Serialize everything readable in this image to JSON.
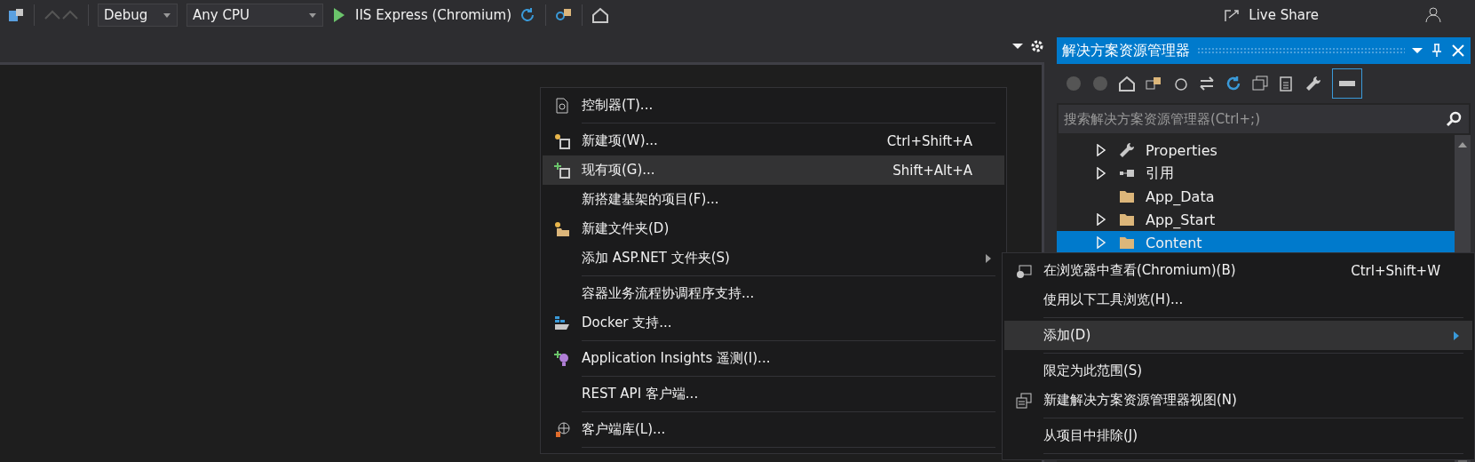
{
  "toolbar": {
    "configuration": "Debug",
    "platform": "Any CPU",
    "run_target": "IIS Express (Chromium)",
    "live_share": "Live Share"
  },
  "solution_explorer": {
    "title": "解决方案资源管理器",
    "search": {
      "placeholder": "搜索解决方案资源管理器(Ctrl+;)"
    },
    "tree": [
      {
        "label": "Properties",
        "kind": "wrench",
        "expandable": true,
        "selected": false
      },
      {
        "label": "引用",
        "kind": "references",
        "expandable": true,
        "selected": false
      },
      {
        "label": "App_Data",
        "kind": "folder",
        "expandable": false,
        "selected": false
      },
      {
        "label": "App_Start",
        "kind": "folder",
        "expandable": true,
        "selected": false
      },
      {
        "label": "Content",
        "kind": "folder",
        "expandable": true,
        "selected": true
      }
    ]
  },
  "add_submenu": {
    "items": [
      {
        "kind": "controller",
        "label": "控制器(T)...",
        "submenu": false,
        "selected": false
      },
      {
        "kind": "separator"
      },
      {
        "kind": "new-item",
        "label": "新建项(W)...",
        "shortcut": "Ctrl+Shift+A",
        "submenu": false,
        "selected": false
      },
      {
        "kind": "existing-item",
        "label": "现有项(G)...",
        "shortcut": "Shift+Alt+A",
        "submenu": false,
        "selected": true
      },
      {
        "kind": "plain",
        "label": "新搭建基架的项目(F)...",
        "submenu": false,
        "selected": false
      },
      {
        "kind": "new-folder",
        "label": "新建文件夹(D)",
        "submenu": false,
        "selected": false
      },
      {
        "kind": "plain",
        "label": "添加 ASP.NET 文件夹(S)",
        "submenu": true,
        "selected": false
      },
      {
        "kind": "separator"
      },
      {
        "kind": "plain",
        "label": "容器业务流程协调程序支持...",
        "submenu": false,
        "selected": false
      },
      {
        "kind": "docker",
        "label": "Docker 支持...",
        "submenu": false,
        "selected": false
      },
      {
        "kind": "separator"
      },
      {
        "kind": "insights",
        "label": "Application Insights 遥测(I)...",
        "submenu": false,
        "selected": false
      },
      {
        "kind": "separator"
      },
      {
        "kind": "plain",
        "label": "REST API 客户端...",
        "submenu": false,
        "selected": false
      },
      {
        "kind": "separator"
      },
      {
        "kind": "library",
        "label": "客户端库(L)...",
        "submenu": false,
        "selected": false
      },
      {
        "kind": "separator"
      }
    ]
  },
  "folder_menu": {
    "items": [
      {
        "kind": "browser",
        "label": "在浏览器中查看(Chromium)(B)",
        "shortcut": "Ctrl+Shift+W",
        "submenu": false,
        "selected": false
      },
      {
        "kind": "plain",
        "label": "使用以下工具浏览(H)...",
        "submenu": false,
        "selected": false
      },
      {
        "kind": "separator"
      },
      {
        "kind": "plain",
        "label": "添加(D)",
        "submenu": true,
        "selected": true
      },
      {
        "kind": "separator"
      },
      {
        "kind": "plain",
        "label": "限定为此范围(S)",
        "submenu": false,
        "selected": false
      },
      {
        "kind": "new-view",
        "label": "新建解决方案资源管理器视图(N)",
        "submenu": false,
        "selected": false
      },
      {
        "kind": "separator"
      },
      {
        "kind": "plain",
        "label": "从项目中排除(J)",
        "submenu": false,
        "selected": false
      },
      {
        "kind": "separator"
      }
    ]
  }
}
